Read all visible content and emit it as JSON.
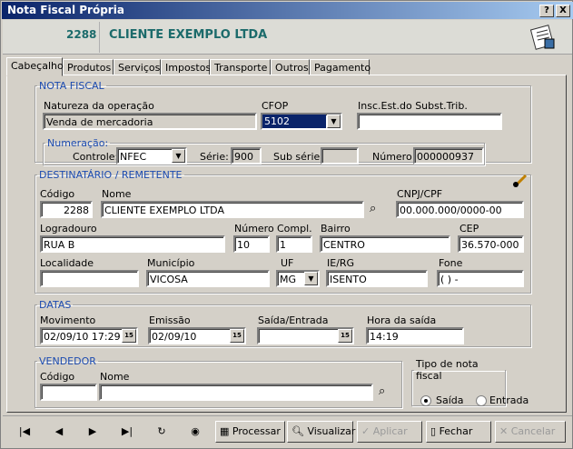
{
  "window": {
    "title": "Nota Fiscal Própria",
    "help_btn": "?",
    "close_btn": "X"
  },
  "header": {
    "code": "2288",
    "name": "CLIENTE EXEMPLO LTDA"
  },
  "tabs": [
    "Cabeçalho",
    "Produtos",
    "Serviços",
    "Impostos",
    "Transporte",
    "Outros",
    "Pagamento"
  ],
  "nota_fiscal": {
    "legend": "NOTA FISCAL",
    "natureza_label": "Natureza da operação",
    "natureza_value": "Venda de mercadoria",
    "cfop_label": "CFOP",
    "cfop_value": "5102",
    "insc_label": "Insc.Est.do Subst.Trib.",
    "insc_value": "",
    "numeracao_legend": "Numeração:",
    "controle_label": "Controle:",
    "controle_value": "NFEC",
    "serie_label": "Série:",
    "serie_value": "900",
    "subserie_label": "Sub série:",
    "subserie_value": "",
    "numero_label": "Número:",
    "numero_value": "000000937"
  },
  "destinatario": {
    "legend": "DESTINATÁRIO / REMETENTE",
    "codigo_label": "Código",
    "codigo_value": "2288",
    "nome_label": "Nome",
    "nome_value": "CLIENTE EXEMPLO LTDA",
    "cnpj_label": "CNPJ/CPF",
    "cnpj_value": "00.000.000/0000-00",
    "logradouro_label": "Logradouro",
    "logradouro_value": "RUA B",
    "numero_label": "Número",
    "numero_value": "10",
    "compl_label": "Compl.",
    "compl_value": "1",
    "bairro_label": "Bairro",
    "bairro_value": "CENTRO",
    "cep_label": "CEP",
    "cep_value": "36.570-000",
    "localidade_label": "Localidade",
    "localidade_value": "",
    "municipio_label": "Município",
    "municipio_value": "VICOSA",
    "uf_label": "UF",
    "uf_value": "MG",
    "ierg_label": "IE/RG",
    "ierg_value": "ISENTO",
    "fone_label": "Fone",
    "fone_value": "(  )    -"
  },
  "datas": {
    "legend": "DATAS",
    "movimento_label": "Movimento",
    "movimento_value": "02/09/10  17:29",
    "emissao_label": "Emissão",
    "emissao_value": "02/09/10",
    "saida_label": "Saída/Entrada",
    "saida_value": "",
    "hora_label": "Hora da saída",
    "hora_value": "14:19",
    "cal_glyph": "15"
  },
  "vendedor": {
    "legend": "VENDEDOR",
    "codigo_label": "Código",
    "codigo_value": "",
    "nome_label": "Nome",
    "nome_value": ""
  },
  "tipo_nota": {
    "legend": "Tipo de nota fiscal",
    "saida_label": "Saída",
    "entrada_label": "Entrada",
    "selected": "Saída"
  },
  "toolbar": {
    "nav_first": "|◀",
    "nav_prev": "◀",
    "nav_next": "▶",
    "nav_last": "▶|",
    "processar": "Processar",
    "visualizar": "Visualizar",
    "aplicar": "Aplicar",
    "fechar": "Fechar",
    "cancelar": "Cancelar"
  },
  "colors": {
    "accent": "#1c6b6b",
    "legend": "#1c4bb0",
    "titlebar": "#0a246a"
  }
}
